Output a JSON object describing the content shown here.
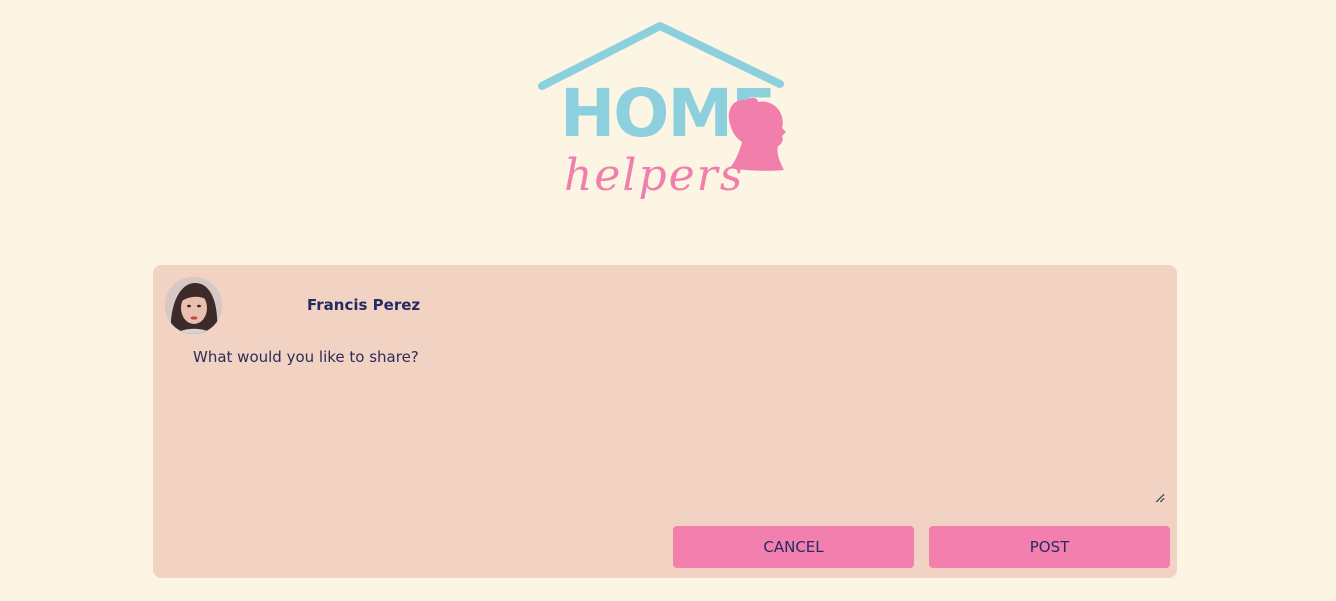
{
  "logo": {
    "line1": "HOME",
    "line2": "helpers",
    "colors": {
      "blue": "#8ccfdd",
      "pink": "#f07fab"
    }
  },
  "composer": {
    "user_name": "Francis Perez",
    "avatar_icon": "user-photo",
    "placeholder": "What would you like to share?",
    "value": "",
    "cancel_label": "CANCEL",
    "post_label": "POST"
  },
  "colors": {
    "page_background": "#fdf5e4",
    "card_background": "#f2d2c2",
    "button_background": "#f37fae",
    "text": "#262a63"
  }
}
